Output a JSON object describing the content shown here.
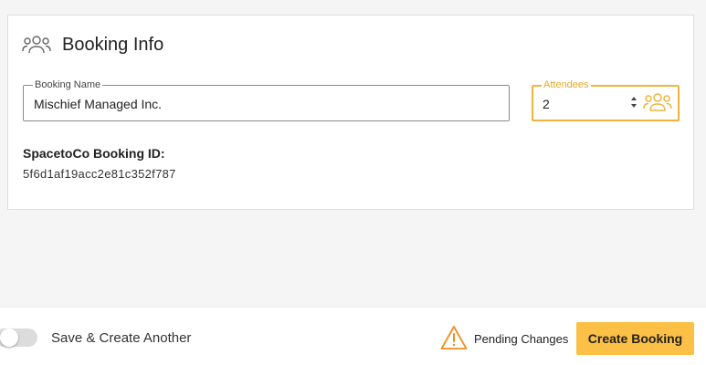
{
  "card": {
    "title": "Booking Info",
    "icon": "people-group-icon"
  },
  "booking_name": {
    "label": "Booking Name",
    "value": "Mischief Managed Inc."
  },
  "attendees": {
    "label": "Attendees",
    "value": "2",
    "icon": "people-group-icon",
    "accent_color": "#f0b43c"
  },
  "booking_id": {
    "label": "SpacetoCo Booking ID:",
    "value": "5f6d1af19acc2e81c352f787"
  },
  "footer": {
    "toggle_label": "Save & Create Another",
    "toggle_on": false,
    "pending_label": "Pending Changes",
    "warning_icon": "warning-triangle-icon",
    "warning_color": "#f28c1c",
    "create_button_label": "Create Booking",
    "create_button_color": "#fbc045"
  }
}
